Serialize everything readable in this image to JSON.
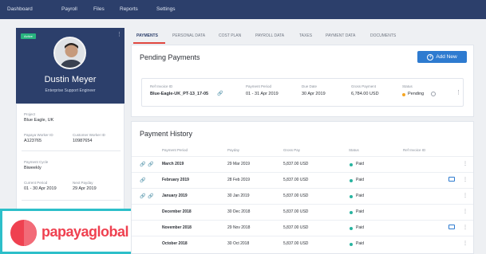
{
  "nav": {
    "items": [
      "Dashboard",
      "Payroll",
      "Files",
      "Reports",
      "Settings"
    ]
  },
  "profile": {
    "status": "Active",
    "name": "Dustin Meyer",
    "role": "Enterprise Support Engineer",
    "project_label": "Project",
    "project": "Blue Eagle, UK",
    "papaya_id_label": "Papaya Worker ID",
    "papaya_id": "A123765",
    "customer_id_label": "Customer Worker ID",
    "customer_id": "10987654",
    "cycle_label": "Payment Cycle",
    "cycle": "Biweekly",
    "current_period_label": "Current Period",
    "current_period": "01 - 30 Apr 2019",
    "next_payday_label": "Next Payday",
    "next_payday": "29 Apr 2019"
  },
  "logo": {
    "text": "papayaglobal"
  },
  "tabs": [
    "PAYMENTS",
    "PERSONAL DATA",
    "COST PLAN",
    "PAYROLL DATA",
    "TAXES",
    "PAYMENT DATA",
    "DOCUMENTS"
  ],
  "pending": {
    "title": "Pending Payments",
    "add_label": "Add New",
    "ref_label": "Ref Invoice ID",
    "ref": "Blue-Eagle-UK_PT-13_17-05",
    "period_label": "Payment Period",
    "period": "01 - 31 Apr 2019",
    "due_label": "Due Date",
    "due": "30 Apr 2019",
    "gross_label": "Gross Payment",
    "gross": "6,784.00 USD",
    "status_label": "Status",
    "status": "Pending",
    "status_color": "#f5a623"
  },
  "history": {
    "title": "Payment History",
    "headers": [
      "Payment Period",
      "Payday",
      "Gross Pay",
      "Status",
      "Ref Invoice ID"
    ],
    "rows": [
      {
        "period": "March 2019",
        "payday": "29 Mar 2019",
        "gross": "5,837.00 USD",
        "status": "Paid",
        "icons": 2,
        "comment": false
      },
      {
        "period": "February 2019",
        "payday": "28 Feb 2019",
        "gross": "5,837.00 USD",
        "status": "Paid",
        "icons": 1,
        "comment": true
      },
      {
        "period": "January 2019",
        "payday": "30 Jan 2019",
        "gross": "5,837.00 USD",
        "status": "Paid",
        "icons": 2,
        "comment": false
      },
      {
        "period": "December 2018",
        "payday": "30 Dec 2018",
        "gross": "5,837.00 USD",
        "status": "Paid",
        "icons": 0,
        "comment": false
      },
      {
        "period": "November 2018",
        "payday": "29 Nov 2018",
        "gross": "5,837.00 USD",
        "status": "Paid",
        "icons": 0,
        "comment": true
      },
      {
        "period": "October 2018",
        "payday": "30 Oct 2018",
        "gross": "5,837.00 USD",
        "status": "Paid",
        "icons": 0,
        "comment": false
      }
    ]
  },
  "colors": {
    "nav": "#2c3f6b",
    "accent": "#2e7bd0",
    "paid": "#29b4a0",
    "brand": "#ef4150"
  }
}
